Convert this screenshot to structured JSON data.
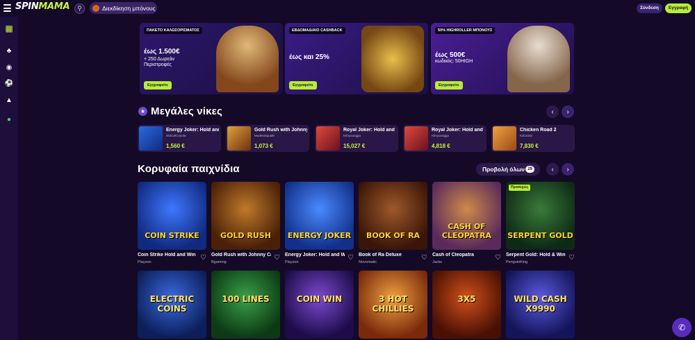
{
  "header": {
    "logo_part1": "SPIN",
    "logo_part2": "MAMA",
    "bonus_button": "Διεκδίκηση μπόνους",
    "login": "Σύνδεση",
    "signup": "Εγγραφή"
  },
  "promos": [
    {
      "tag": "ΠΑΚΕΤΟ ΚΑΛΩΣΟΡΙΣΜΑΤΟΣ",
      "head": "έως 1.500€",
      "sub1": "+ 250 Δωρεάν",
      "sub2": "Περιστροφές",
      "cta": "Εγγραφείτε",
      "color": "#2f1870"
    },
    {
      "tag": "ΕΒΔΟΜΑΔΙΑΙΟ CASHBACK",
      "head": "έως και 25%",
      "sub1": "",
      "sub2": "",
      "cta": "Εγγραφείτε",
      "color": "#3a1c86"
    },
    {
      "tag": "50% HIGHROLLER ΜΠΟΝΟΥΣ",
      "head": "έως 500€",
      "sub1": "κωδικός: 50HIGH",
      "sub2": "",
      "cta": "Εγγραφείτε",
      "color": "#4b1e96"
    }
  ],
  "big_wins": {
    "title": "Μεγάλες νίκες",
    "items": [
      {
        "name": "Energy Joker: Hold and Win",
        "user": "003CelCoyote",
        "amount": "1,560 €",
        "color": "#1b4fb8"
      },
      {
        "name": "Gold Rush with Johnny Cash",
        "user": "ModestSquid9",
        "amount": "1,073 €",
        "color": "#7a3b10"
      },
      {
        "name": "Royal Joker: Hold and Win",
        "user": "Klmyounggu",
        "amount": "15,027 €",
        "color": "#8a1c2a"
      },
      {
        "name": "Royal Joker: Hold and Win",
        "user": "Klmyounggu",
        "amount": "4,818 €",
        "color": "#8a1c2a"
      },
      {
        "name": "Chicken Road 2",
        "user": "Kdc2343",
        "amount": "7,830 €",
        "color": "#c9702a"
      }
    ]
  },
  "top_games": {
    "title": "Κορυφαία παιχνίδια",
    "view_all": "Προβολή όλων",
    "count": "29",
    "row1": [
      {
        "tile_text": "COIN STRIKE",
        "name": "Coin Strike Hold and Win",
        "provider": "Playson",
        "badge": "",
        "color": "#1a3a9e"
      },
      {
        "tile_text": "GOLD RUSH",
        "name": "Gold Rush with Johnny Cash",
        "provider": "Bgaming",
        "badge": "",
        "color": "#7a3a14"
      },
      {
        "tile_text": "ENERGY JOKER",
        "name": "Energy Joker: Hold and Win",
        "provider": "Playson",
        "badge": "",
        "color": "#1d4fc4"
      },
      {
        "tile_text": "BOOK OF RA",
        "name": "Book of Ra Deluxe",
        "provider": "Novomatic",
        "badge": "",
        "color": "#5a2a12"
      },
      {
        "tile_text": "CASH OF CLEOPATRA",
        "name": "Cash of Cleopatra",
        "provider": "Jacks",
        "badge": "",
        "color": "#8a4a8c"
      },
      {
        "tile_text": "SERPENT GOLD",
        "name": "Serpent Gold: Hold & Win",
        "provider": "PenguinKing",
        "badge": "Προσεχώς",
        "color": "#1f4a2a"
      }
    ],
    "row2": [
      {
        "tile_text": "ELECTRIC COINS",
        "color": "#1c3f8c"
      },
      {
        "tile_text": "100 LINES",
        "color": "#1e6a2a"
      },
      {
        "tile_text": "COIN WIN",
        "color": "#3a1a7a"
      },
      {
        "tile_text": "3 HOT CHILLIES",
        "color": "#a8461a"
      },
      {
        "tile_text": "3X5",
        "color": "#8a2a0a"
      },
      {
        "tile_text": "WILD CASH X9990",
        "color": "#2a2a9a"
      }
    ]
  }
}
